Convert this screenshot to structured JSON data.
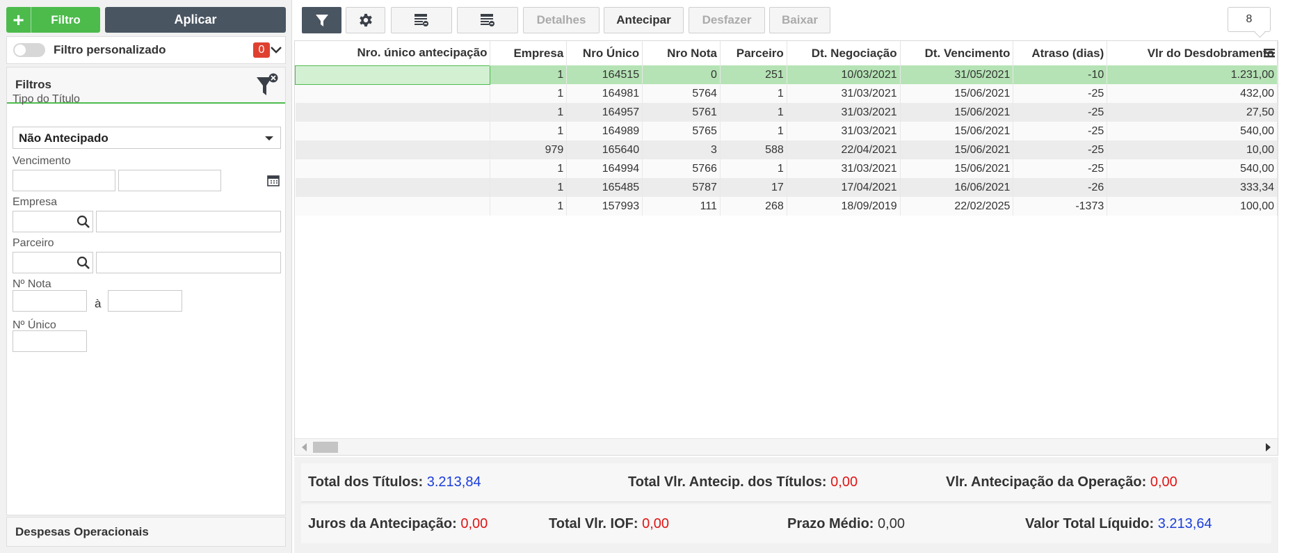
{
  "sidebar": {
    "filter_button": {
      "icon": "plus-icon",
      "label": "Filtro"
    },
    "apply_button": "Aplicar",
    "custom_filter": {
      "label": "Filtro personalizado",
      "count": "0",
      "enabled": false
    },
    "filters_title": "Filtros",
    "fields": {
      "tipo_titulo": {
        "label": "Tipo do Título",
        "value": "Não Antecipado"
      },
      "vencimento": {
        "label": "Vencimento",
        "from": "",
        "to": ""
      },
      "empresa": {
        "label": "Empresa",
        "code": "",
        "name": ""
      },
      "parceiro": {
        "label": "Parceiro",
        "code": "",
        "name": ""
      },
      "nota": {
        "label": "Nº Nota",
        "from": "",
        "separator": "à",
        "to": ""
      },
      "unico": {
        "label": "Nº Único",
        "value": ""
      }
    },
    "footer_section": "Despesas Operacionais"
  },
  "toolbar": {
    "filter_icon": "funnel-icon",
    "settings_icon": "gear-icon",
    "details": "Detalhes",
    "antecipar": "Antecipar",
    "desfazer": "Desfazer",
    "baixar": "Baixar",
    "record_count": "8"
  },
  "grid": {
    "columns": [
      "Nro. único antecipação",
      "Empresa",
      "Nro Único",
      "Nro Nota",
      "Parceiro",
      "Dt. Negociação",
      "Dt. Vencimento",
      "Atraso (dias)",
      "Vlr do Desdobramento"
    ],
    "rows": [
      [
        "",
        "1",
        "164515",
        "0",
        "251",
        "10/03/2021",
        "31/05/2021",
        "-10",
        "1.231,00"
      ],
      [
        "",
        "1",
        "164981",
        "5764",
        "1",
        "31/03/2021",
        "15/06/2021",
        "-25",
        "432,00"
      ],
      [
        "",
        "1",
        "164957",
        "5761",
        "1",
        "31/03/2021",
        "15/06/2021",
        "-25",
        "27,50"
      ],
      [
        "",
        "1",
        "164989",
        "5765",
        "1",
        "31/03/2021",
        "15/06/2021",
        "-25",
        "540,00"
      ],
      [
        "",
        "979",
        "165640",
        "3",
        "588",
        "22/04/2021",
        "15/06/2021",
        "-25",
        "10,00"
      ],
      [
        "",
        "1",
        "164994",
        "5766",
        "1",
        "31/03/2021",
        "15/06/2021",
        "-25",
        "540,00"
      ],
      [
        "",
        "1",
        "165485",
        "5787",
        "17",
        "17/04/2021",
        "16/06/2021",
        "-26",
        "333,34"
      ],
      [
        "",
        "1",
        "157993",
        "111",
        "268",
        "18/09/2019",
        "22/02/2025",
        "-1373",
        "100,00"
      ]
    ],
    "selected_row": 0
  },
  "totals": {
    "total_titulos": {
      "label": "Total dos Títulos:",
      "value": "3.213,84"
    },
    "total_antecip": {
      "label": "Total Vlr. Antecip. dos Títulos:",
      "value": "0,00"
    },
    "vlr_operacao": {
      "label": "Vlr. Antecipação da Operação:",
      "value": "0,00"
    },
    "juros": {
      "label": "Juros da Antecipação:",
      "value": "0,00"
    },
    "iof": {
      "label": "Total Vlr. IOF:",
      "value": "0,00"
    },
    "prazo": {
      "label": "Prazo Médio:",
      "value": "0,00"
    },
    "liquido": {
      "label": "Valor Total Líquido:",
      "value": "3.213,64"
    }
  },
  "colors": {
    "accent_green": "#4cbb4c",
    "dark_button": "#4a5562",
    "blue_value": "#1a3ddb",
    "red_value": "#e01515",
    "badge_red": "#e04030"
  }
}
